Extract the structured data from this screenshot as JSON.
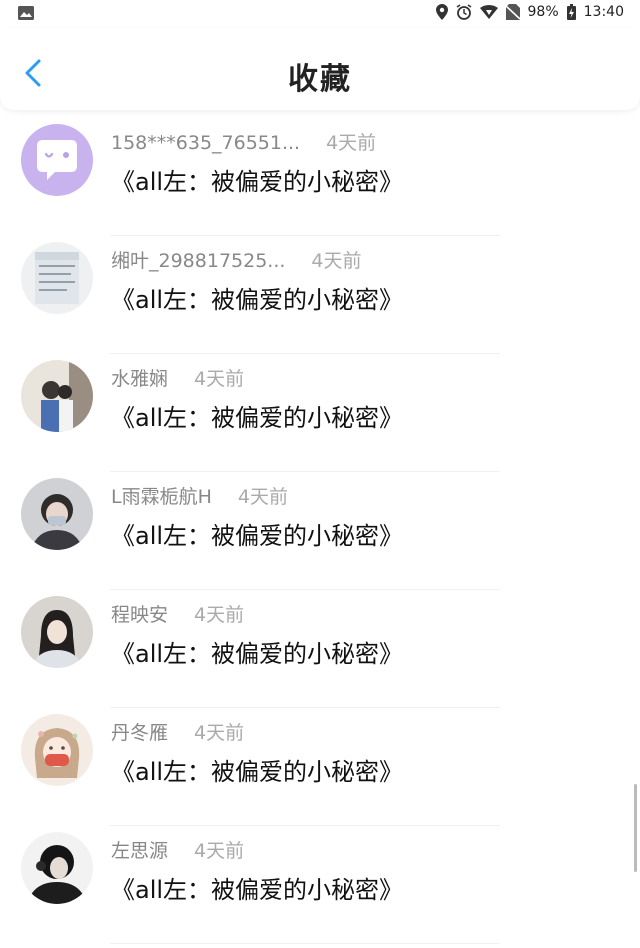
{
  "status_bar": {
    "battery": "98%",
    "time": "13:40"
  },
  "header": {
    "title": "收藏"
  },
  "items": [
    {
      "user": "158***635_76551...",
      "time": "4天前",
      "content": "《all左：被偏爱的小秘密》",
      "avatar": "chat-bubble-avatar"
    },
    {
      "user": "缃叶_298817525...",
      "time": "4天前",
      "content": "《all左：被偏爱的小秘密》",
      "avatar": "text-image-avatar"
    },
    {
      "user": "水雅娴",
      "time": "4天前",
      "content": "《all左：被偏爱的小秘密》",
      "avatar": "photo-avatar"
    },
    {
      "user": "L雨霖栀航H",
      "time": "4天前",
      "content": "《all左：被偏爱的小秘密》",
      "avatar": "photo-avatar"
    },
    {
      "user": "程映安",
      "time": "4天前",
      "content": "《all左：被偏爱的小秘密》",
      "avatar": "photo-avatar"
    },
    {
      "user": "丹冬雁",
      "time": "4天前",
      "content": "《all左：被偏爱的小秘密》",
      "avatar": "illustration-avatar"
    },
    {
      "user": "左思源",
      "time": "4天前",
      "content": "《all左：被偏爱的小秘密》",
      "avatar": "photo-avatar"
    }
  ]
}
